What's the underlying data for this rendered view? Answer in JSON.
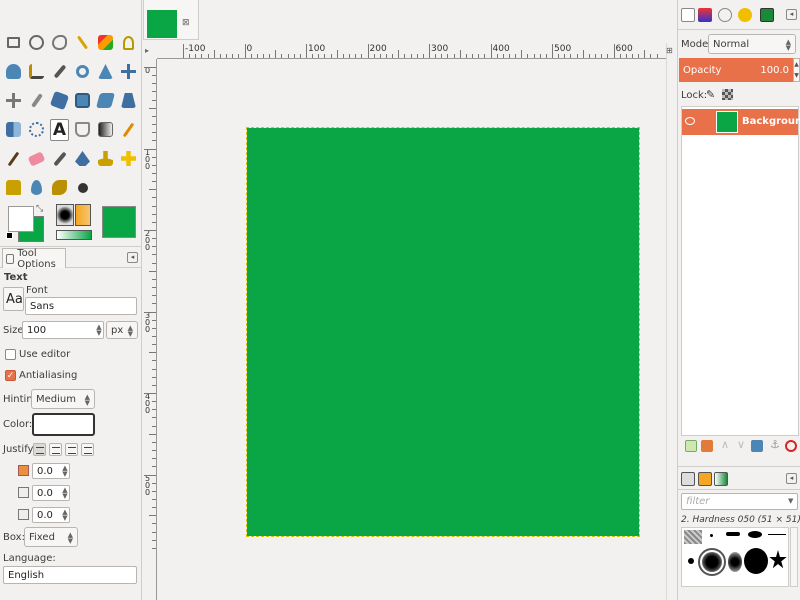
{
  "tool_options": {
    "tab_label": "Tool Options",
    "tool_name": "Text",
    "font_label": "Font",
    "font_preview": "Aa",
    "font_value": "Sans",
    "size_label": "Size:",
    "size_value": "100",
    "size_unit": "px",
    "use_editor_label": "Use editor",
    "antialiasing_label": "Antialiasing",
    "hinting_label": "Hinting:",
    "hinting_value": "Medium",
    "color_label": "Color:",
    "justify_label": "Justify:",
    "indent_value": "0.0",
    "line_spacing_value": "0.0",
    "letter_spacing_value": "0.0",
    "box_label": "Box:",
    "box_value": "Fixed",
    "language_label": "Language:",
    "language_value": "English"
  },
  "rulers": {
    "h_labels": [
      "-100",
      "0",
      "100",
      "200",
      "300",
      "400",
      "500",
      "600"
    ],
    "v_labels": [
      "0",
      "100",
      "200",
      "300",
      "400",
      "500"
    ]
  },
  "layers": {
    "mode_label": "Mode:",
    "mode_value": "Normal",
    "opacity_label": "Opacity",
    "opacity_value": "100.0",
    "lock_label": "Lock:",
    "layer_name": "Background"
  },
  "brushes": {
    "filter_placeholder": "filter",
    "brush_name": "2. Hardness 050 (51 × 51)"
  },
  "colors": {
    "canvas_fill": "#0aa544",
    "accent": "#e9714a",
    "foreground": "#ffffff",
    "background": "#0aa544"
  }
}
